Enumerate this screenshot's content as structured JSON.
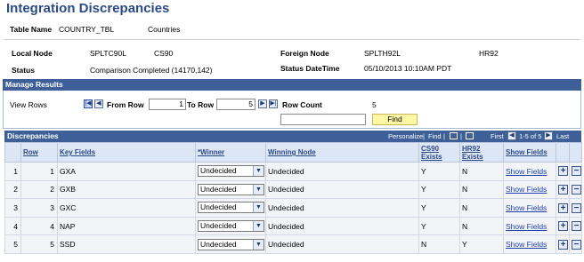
{
  "page_title": "Integration Discrepancies",
  "table_name": {
    "label": "Table Name",
    "value": "COUNTRY_TBL",
    "description": "Countries"
  },
  "local_node": {
    "label": "Local Node",
    "node": "SPLTC90L",
    "db": "CS90"
  },
  "foreign_node": {
    "label": "Foreign Node",
    "node": "SPLTH92L",
    "db": "HR92"
  },
  "status": {
    "label": "Status",
    "value": "Comparison Completed (14170,142)"
  },
  "status_datetime": {
    "label": "Status DateTime",
    "value": "05/10/2013 10:10AM PDT"
  },
  "manage_results": {
    "header": "Manage Results",
    "view_rows_label": "View Rows",
    "from_row_label": "From Row",
    "from_row_value": "1",
    "to_row_label": "To Row",
    "to_row_value": "5",
    "row_count_label": "Row Count",
    "row_count_value": "5",
    "find_input_value": "",
    "find_button": "Find"
  },
  "discrepancies": {
    "header": "Discrepancies",
    "personalize": "Personalize",
    "find": "Find",
    "first": "First",
    "range": "1-5 of 5",
    "last": "Last",
    "columns": {
      "row": "Row",
      "key_fields": "Key Fields",
      "winner": "*Winner",
      "winning_node": "Winning Node",
      "cs90_exists": "CS90 Exists",
      "hr92_exists": "HR92 Exists",
      "show_fields": "Show Fields"
    },
    "rows": [
      {
        "idx": "1",
        "row": "1",
        "key": "GXA",
        "winner": "Undecided",
        "winning_node": "Undecided",
        "cs90": "Y",
        "hr92": "N",
        "show": "Show Fields"
      },
      {
        "idx": "2",
        "row": "2",
        "key": "GXB",
        "winner": "Undecided",
        "winning_node": "Undecided",
        "cs90": "Y",
        "hr92": "N",
        "show": "Show Fields"
      },
      {
        "idx": "3",
        "row": "3",
        "key": "GXC",
        "winner": "Undecided",
        "winning_node": "Undecided",
        "cs90": "Y",
        "hr92": "N",
        "show": "Show Fields"
      },
      {
        "idx": "4",
        "row": "4",
        "key": "NAP",
        "winner": "Undecided",
        "winning_node": "Undecided",
        "cs90": "Y",
        "hr92": "N",
        "show": "Show Fields"
      },
      {
        "idx": "5",
        "row": "5",
        "key": "SSD",
        "winner": "Undecided",
        "winning_node": "Undecided",
        "cs90": "N",
        "hr92": "Y",
        "show": "Show Fields"
      }
    ]
  },
  "icons": {
    "first_page": "first-page-icon",
    "prev_page": "previous-page-icon",
    "next_page": "next-page-icon",
    "last_page": "last-page-icon",
    "dropdown": "chevron-down-icon",
    "add_row": "plus-icon",
    "delete_row": "minus-icon"
  },
  "colors": {
    "title": "#2c4a86",
    "section_header": "#3e5f97",
    "column_header_bg": "#dde6f4",
    "row_bg": "#f2f4f8",
    "find_button_bg": "#fdf6a5",
    "link": "#1f3fa8"
  }
}
